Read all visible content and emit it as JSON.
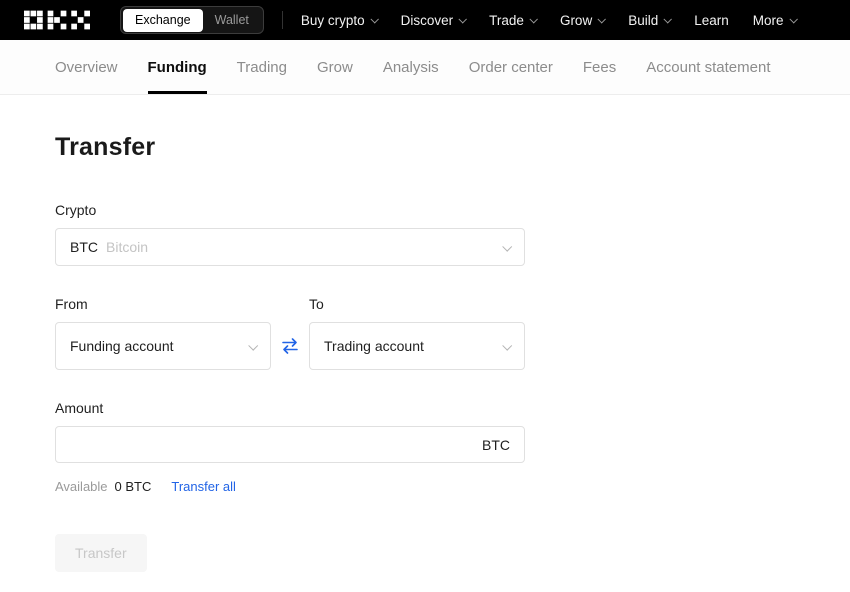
{
  "navbar": {
    "logo_alt": "OKX",
    "toggle": {
      "exchange": "Exchange",
      "wallet": "Wallet"
    },
    "items": [
      {
        "label": "Buy crypto"
      },
      {
        "label": "Discover"
      },
      {
        "label": "Trade"
      },
      {
        "label": "Grow"
      },
      {
        "label": "Build"
      },
      {
        "label": "Learn"
      },
      {
        "label": "More"
      }
    ]
  },
  "tabs": [
    {
      "label": "Overview"
    },
    {
      "label": "Funding"
    },
    {
      "label": "Trading"
    },
    {
      "label": "Grow"
    },
    {
      "label": "Analysis"
    },
    {
      "label": "Order center"
    },
    {
      "label": "Fees"
    },
    {
      "label": "Account statement"
    }
  ],
  "page": {
    "title": "Transfer",
    "crypto": {
      "label": "Crypto",
      "symbol": "BTC",
      "name": "Bitcoin"
    },
    "from": {
      "label": "From",
      "value": "Funding account"
    },
    "to": {
      "label": "To",
      "value": "Trading account"
    },
    "amount": {
      "label": "Amount",
      "suffix": "BTC",
      "value": ""
    },
    "available": {
      "label": "Available",
      "value": "0 BTC",
      "transfer_all": "Transfer all"
    },
    "submit_label": "Transfer"
  },
  "colors": {
    "accent": "#2264e6",
    "navbar_bg": "#000000",
    "active_tab": "#0d0d0d"
  }
}
